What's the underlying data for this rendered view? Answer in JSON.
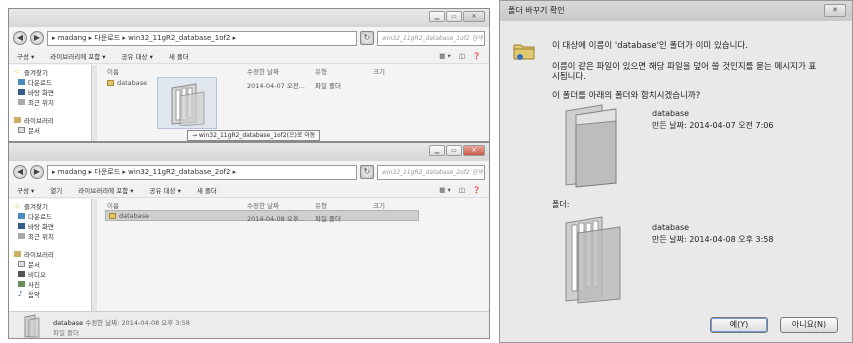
{
  "top_window": {
    "path": "▸ madang ▸ 다운로드 ▸ win32_11gR2_database_1of2 ▸",
    "search_placeholder": "win32_11gR2_database_1of2 검색",
    "toolbar": [
      "구성 ▾",
      "라이브러리에 포함 ▾",
      "공유 대상 ▾",
      "새 폴더"
    ],
    "nav": [
      "즐겨찾기",
      "다운로드",
      "바탕 화면",
      "최근 위치",
      "라이브러리",
      "문서"
    ],
    "columns": [
      "이름",
      "수정한 날짜",
      "유형",
      "크기"
    ],
    "row": {
      "name": "database",
      "date": "2014-04-07 오전...",
      "type": "파일 폴더"
    },
    "drag_tooltip": "→ win32_11gR2_database_1of2(으)로 이동"
  },
  "bottom_window": {
    "path": "▸ madang ▸ 다운로드 ▸ win32_11gR2_database_2of2 ▸",
    "search_placeholder": "win32_11gR2_database_2of2 검색",
    "toolbar": [
      "구성 ▾",
      "열기",
      "라이브러리에 포함 ▾",
      "공유 대상 ▾",
      "새 폴더"
    ],
    "nav": [
      "즐겨찾기",
      "다운로드",
      "바탕 화면",
      "최근 위치",
      "라이브러리",
      "문서",
      "비디오",
      "사진",
      "음악"
    ],
    "columns": [
      "이름",
      "수정한 날짜",
      "유형",
      "크기"
    ],
    "row": {
      "name": "database",
      "date": "2014-04-08 오후...",
      "type": "파일 폴더"
    },
    "status_name": "database",
    "status_date": "수정한 날짜: 2014-04-08 오후 3:58",
    "status_type": "파일 폴더"
  },
  "dialog": {
    "title": "폴더 바꾸기 확인",
    "message1": "이 대상에 이름이 'database'인 폴더가 이미 있습니다.",
    "message2a": "이름이 같은 파일이 있으면 해당 파일을 덮어 쓸 것인지를 묻는 메시지가 표",
    "message2b": "시됩니다.",
    "question": "이 폴더를 아래의 폴더와 합치시겠습니까?",
    "existing_name": "database",
    "existing_date": "만든 날짜: 2014-04-07 오전 7:06",
    "folder_label": "폴더:",
    "new_name": "database",
    "new_date": "만든 날짜: 2014-04-08 오후 3:58",
    "yes": "예(Y)",
    "no": "아니요(N)"
  }
}
